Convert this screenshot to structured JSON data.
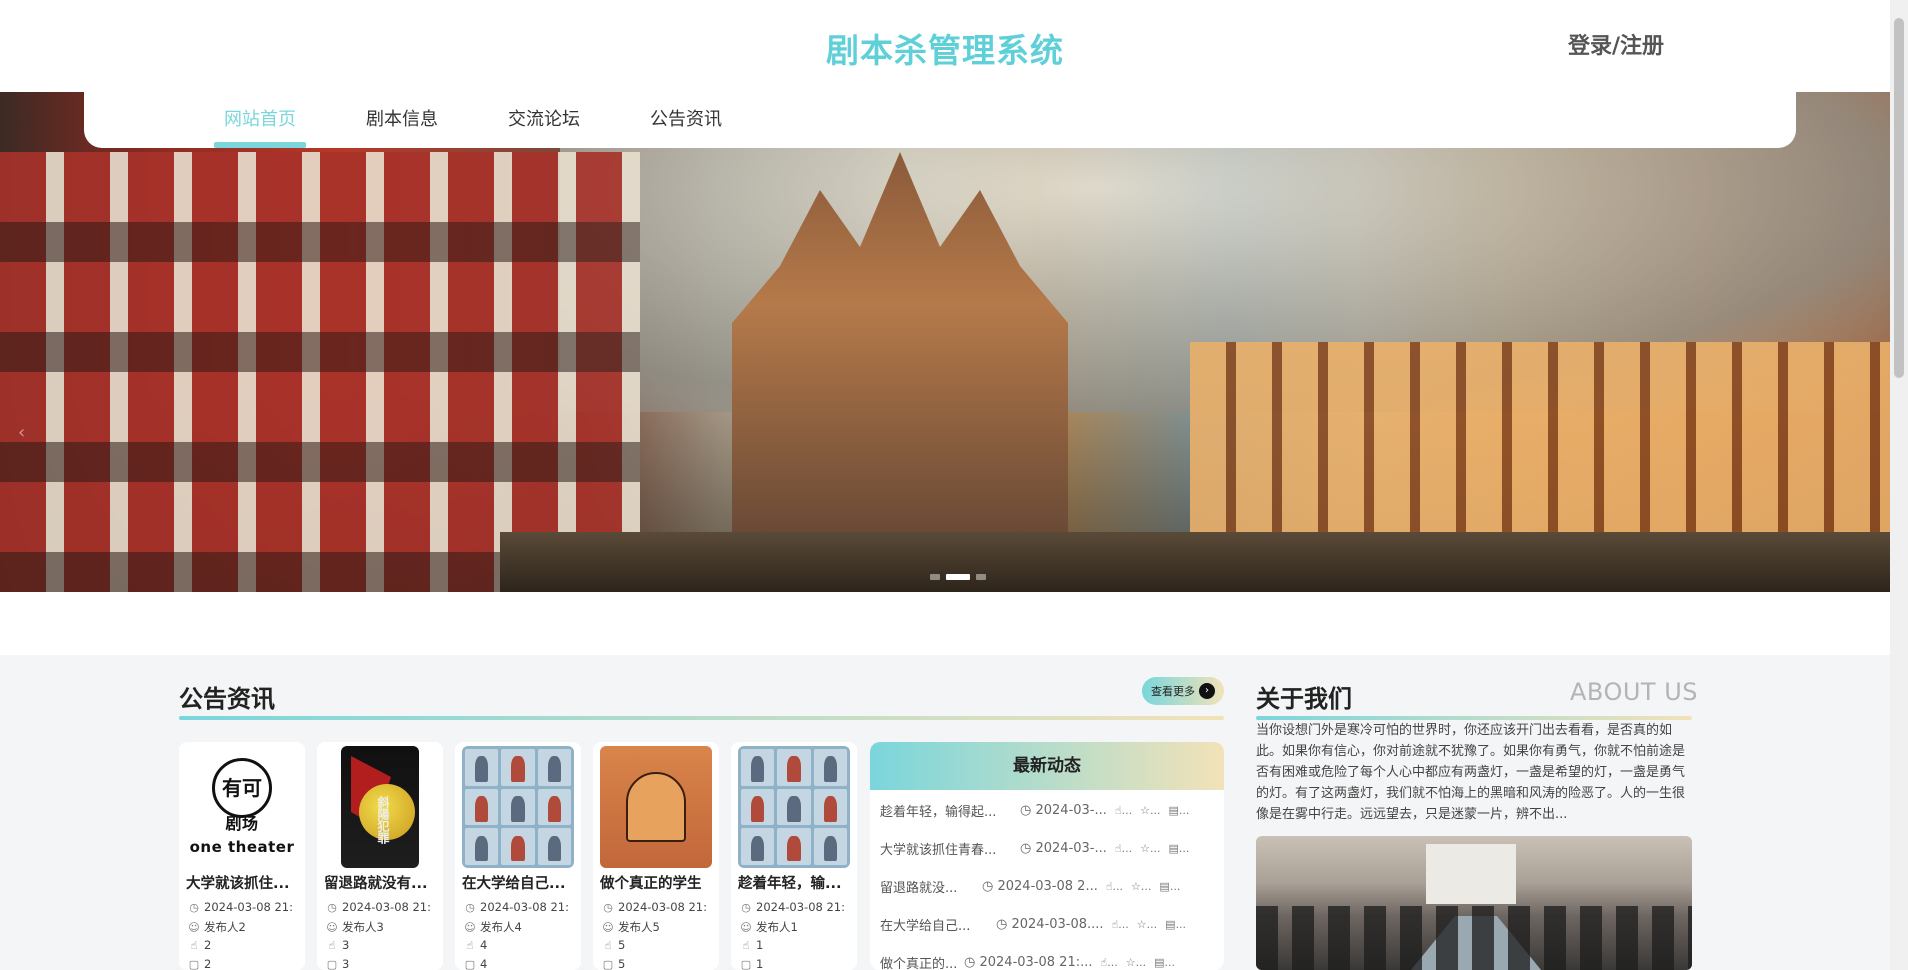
{
  "header": {
    "site_title": "剧本杀管理系统",
    "login_label": "登录/注册"
  },
  "nav": {
    "items": [
      {
        "label": "网站首页",
        "active": true
      },
      {
        "label": "剧本信息",
        "active": false
      },
      {
        "label": "交流论坛",
        "active": false
      },
      {
        "label": "公告资讯",
        "active": false
      }
    ]
  },
  "banner": {
    "slide_count": 3,
    "active_slide": 2
  },
  "notices": {
    "title": "公告资讯",
    "more_label": "查看更多",
    "cards": [
      {
        "title": "大学就该抓住...",
        "date": "2024-03-08 21:",
        "publisher": "发布人2",
        "likes": "2",
        "extra": "2",
        "thumb_text": "有可",
        "thumb_text2": "剧场",
        "thumb_sub": "one theater"
      },
      {
        "title": "留退路就没有...",
        "date": "2024-03-08 21:",
        "publisher": "发布人3",
        "likes": "3",
        "extra": "3",
        "thumb_text": "斜陽犯罪"
      },
      {
        "title": "在大学给自己...",
        "date": "2024-03-08 21:",
        "publisher": "发布人4",
        "likes": "4",
        "extra": "4"
      },
      {
        "title": "做个真正的学生",
        "date": "2024-03-08 21:",
        "publisher": "发布人5",
        "likes": "5",
        "extra": "5"
      },
      {
        "title": "趁着年轻，输...",
        "date": "2024-03-08 21:",
        "publisher": "发布人1",
        "likes": "1",
        "extra": "1"
      }
    ]
  },
  "latest": {
    "title": "最新动态",
    "rows": [
      {
        "title": "趁着年轻，输得起...",
        "date": "2024-03-..."
      },
      {
        "title": "大学就该抓住青春...",
        "date": "2024-03-..."
      },
      {
        "title": "留退路就没...",
        "date": "2024-03-08 2..."
      },
      {
        "title": "在大学给自己...",
        "date": "2024-03-08...."
      },
      {
        "title": "做个真正的...",
        "date": "2024-03-08 21:..."
      }
    ],
    "icon_text": "..."
  },
  "about": {
    "title": "关于我们",
    "title_en": "ABOUT US",
    "text": "当你设想门外是寒冷可怕的世界时，你还应该开门出去看看，是否真的如此。如果你有信心，你对前途就不犹豫了。如果你有勇气，你就不怕前途是否有困难或危险了每个人心中都应有两盏灯，一盏是希望的灯，一盏是勇气的灯。有了这两盏灯，我们就不怕海上的黑暗和风涛的险恶了。人的一生很像是在雾中行走。远远望去，只是迷蒙一片，辨不出..."
  },
  "colors": {
    "accent": "#7ad6dc",
    "title": "#5fd0d8",
    "gradient_end": "#f2e2b8"
  }
}
